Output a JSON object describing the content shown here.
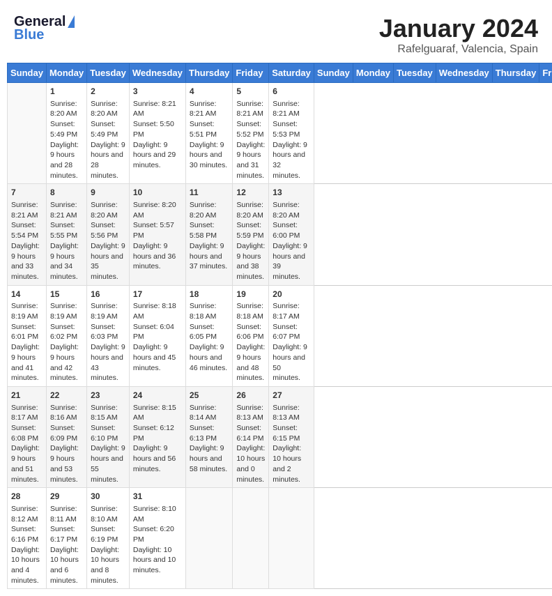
{
  "header": {
    "logo_line1": "General",
    "logo_line2": "Blue",
    "title": "January 2024",
    "location": "Rafelguaraf, Valencia, Spain"
  },
  "days_of_week": [
    "Sunday",
    "Monday",
    "Tuesday",
    "Wednesday",
    "Thursday",
    "Friday",
    "Saturday"
  ],
  "weeks": [
    [
      {
        "day": "",
        "sunrise": "",
        "sunset": "",
        "daylight": ""
      },
      {
        "day": "1",
        "sunrise": "Sunrise: 8:20 AM",
        "sunset": "Sunset: 5:49 PM",
        "daylight": "Daylight: 9 hours and 28 minutes."
      },
      {
        "day": "2",
        "sunrise": "Sunrise: 8:20 AM",
        "sunset": "Sunset: 5:49 PM",
        "daylight": "Daylight: 9 hours and 28 minutes."
      },
      {
        "day": "3",
        "sunrise": "Sunrise: 8:21 AM",
        "sunset": "Sunset: 5:50 PM",
        "daylight": "Daylight: 9 hours and 29 minutes."
      },
      {
        "day": "4",
        "sunrise": "Sunrise: 8:21 AM",
        "sunset": "Sunset: 5:51 PM",
        "daylight": "Daylight: 9 hours and 30 minutes."
      },
      {
        "day": "5",
        "sunrise": "Sunrise: 8:21 AM",
        "sunset": "Sunset: 5:52 PM",
        "daylight": "Daylight: 9 hours and 31 minutes."
      },
      {
        "day": "6",
        "sunrise": "Sunrise: 8:21 AM",
        "sunset": "Sunset: 5:53 PM",
        "daylight": "Daylight: 9 hours and 32 minutes."
      }
    ],
    [
      {
        "day": "7",
        "sunrise": "Sunrise: 8:21 AM",
        "sunset": "Sunset: 5:54 PM",
        "daylight": "Daylight: 9 hours and 33 minutes."
      },
      {
        "day": "8",
        "sunrise": "Sunrise: 8:21 AM",
        "sunset": "Sunset: 5:55 PM",
        "daylight": "Daylight: 9 hours and 34 minutes."
      },
      {
        "day": "9",
        "sunrise": "Sunrise: 8:20 AM",
        "sunset": "Sunset: 5:56 PM",
        "daylight": "Daylight: 9 hours and 35 minutes."
      },
      {
        "day": "10",
        "sunrise": "Sunrise: 8:20 AM",
        "sunset": "Sunset: 5:57 PM",
        "daylight": "Daylight: 9 hours and 36 minutes."
      },
      {
        "day": "11",
        "sunrise": "Sunrise: 8:20 AM",
        "sunset": "Sunset: 5:58 PM",
        "daylight": "Daylight: 9 hours and 37 minutes."
      },
      {
        "day": "12",
        "sunrise": "Sunrise: 8:20 AM",
        "sunset": "Sunset: 5:59 PM",
        "daylight": "Daylight: 9 hours and 38 minutes."
      },
      {
        "day": "13",
        "sunrise": "Sunrise: 8:20 AM",
        "sunset": "Sunset: 6:00 PM",
        "daylight": "Daylight: 9 hours and 39 minutes."
      }
    ],
    [
      {
        "day": "14",
        "sunrise": "Sunrise: 8:19 AM",
        "sunset": "Sunset: 6:01 PM",
        "daylight": "Daylight: 9 hours and 41 minutes."
      },
      {
        "day": "15",
        "sunrise": "Sunrise: 8:19 AM",
        "sunset": "Sunset: 6:02 PM",
        "daylight": "Daylight: 9 hours and 42 minutes."
      },
      {
        "day": "16",
        "sunrise": "Sunrise: 8:19 AM",
        "sunset": "Sunset: 6:03 PM",
        "daylight": "Daylight: 9 hours and 43 minutes."
      },
      {
        "day": "17",
        "sunrise": "Sunrise: 8:18 AM",
        "sunset": "Sunset: 6:04 PM",
        "daylight": "Daylight: 9 hours and 45 minutes."
      },
      {
        "day": "18",
        "sunrise": "Sunrise: 8:18 AM",
        "sunset": "Sunset: 6:05 PM",
        "daylight": "Daylight: 9 hours and 46 minutes."
      },
      {
        "day": "19",
        "sunrise": "Sunrise: 8:18 AM",
        "sunset": "Sunset: 6:06 PM",
        "daylight": "Daylight: 9 hours and 48 minutes."
      },
      {
        "day": "20",
        "sunrise": "Sunrise: 8:17 AM",
        "sunset": "Sunset: 6:07 PM",
        "daylight": "Daylight: 9 hours and 50 minutes."
      }
    ],
    [
      {
        "day": "21",
        "sunrise": "Sunrise: 8:17 AM",
        "sunset": "Sunset: 6:08 PM",
        "daylight": "Daylight: 9 hours and 51 minutes."
      },
      {
        "day": "22",
        "sunrise": "Sunrise: 8:16 AM",
        "sunset": "Sunset: 6:09 PM",
        "daylight": "Daylight: 9 hours and 53 minutes."
      },
      {
        "day": "23",
        "sunrise": "Sunrise: 8:15 AM",
        "sunset": "Sunset: 6:10 PM",
        "daylight": "Daylight: 9 hours and 55 minutes."
      },
      {
        "day": "24",
        "sunrise": "Sunrise: 8:15 AM",
        "sunset": "Sunset: 6:12 PM",
        "daylight": "Daylight: 9 hours and 56 minutes."
      },
      {
        "day": "25",
        "sunrise": "Sunrise: 8:14 AM",
        "sunset": "Sunset: 6:13 PM",
        "daylight": "Daylight: 9 hours and 58 minutes."
      },
      {
        "day": "26",
        "sunrise": "Sunrise: 8:13 AM",
        "sunset": "Sunset: 6:14 PM",
        "daylight": "Daylight: 10 hours and 0 minutes."
      },
      {
        "day": "27",
        "sunrise": "Sunrise: 8:13 AM",
        "sunset": "Sunset: 6:15 PM",
        "daylight": "Daylight: 10 hours and 2 minutes."
      }
    ],
    [
      {
        "day": "28",
        "sunrise": "Sunrise: 8:12 AM",
        "sunset": "Sunset: 6:16 PM",
        "daylight": "Daylight: 10 hours and 4 minutes."
      },
      {
        "day": "29",
        "sunrise": "Sunrise: 8:11 AM",
        "sunset": "Sunset: 6:17 PM",
        "daylight": "Daylight: 10 hours and 6 minutes."
      },
      {
        "day": "30",
        "sunrise": "Sunrise: 8:10 AM",
        "sunset": "Sunset: 6:19 PM",
        "daylight": "Daylight: 10 hours and 8 minutes."
      },
      {
        "day": "31",
        "sunrise": "Sunrise: 8:10 AM",
        "sunset": "Sunset: 6:20 PM",
        "daylight": "Daylight: 10 hours and 10 minutes."
      },
      {
        "day": "",
        "sunrise": "",
        "sunset": "",
        "daylight": ""
      },
      {
        "day": "",
        "sunrise": "",
        "sunset": "",
        "daylight": ""
      },
      {
        "day": "",
        "sunrise": "",
        "sunset": "",
        "daylight": ""
      }
    ]
  ]
}
